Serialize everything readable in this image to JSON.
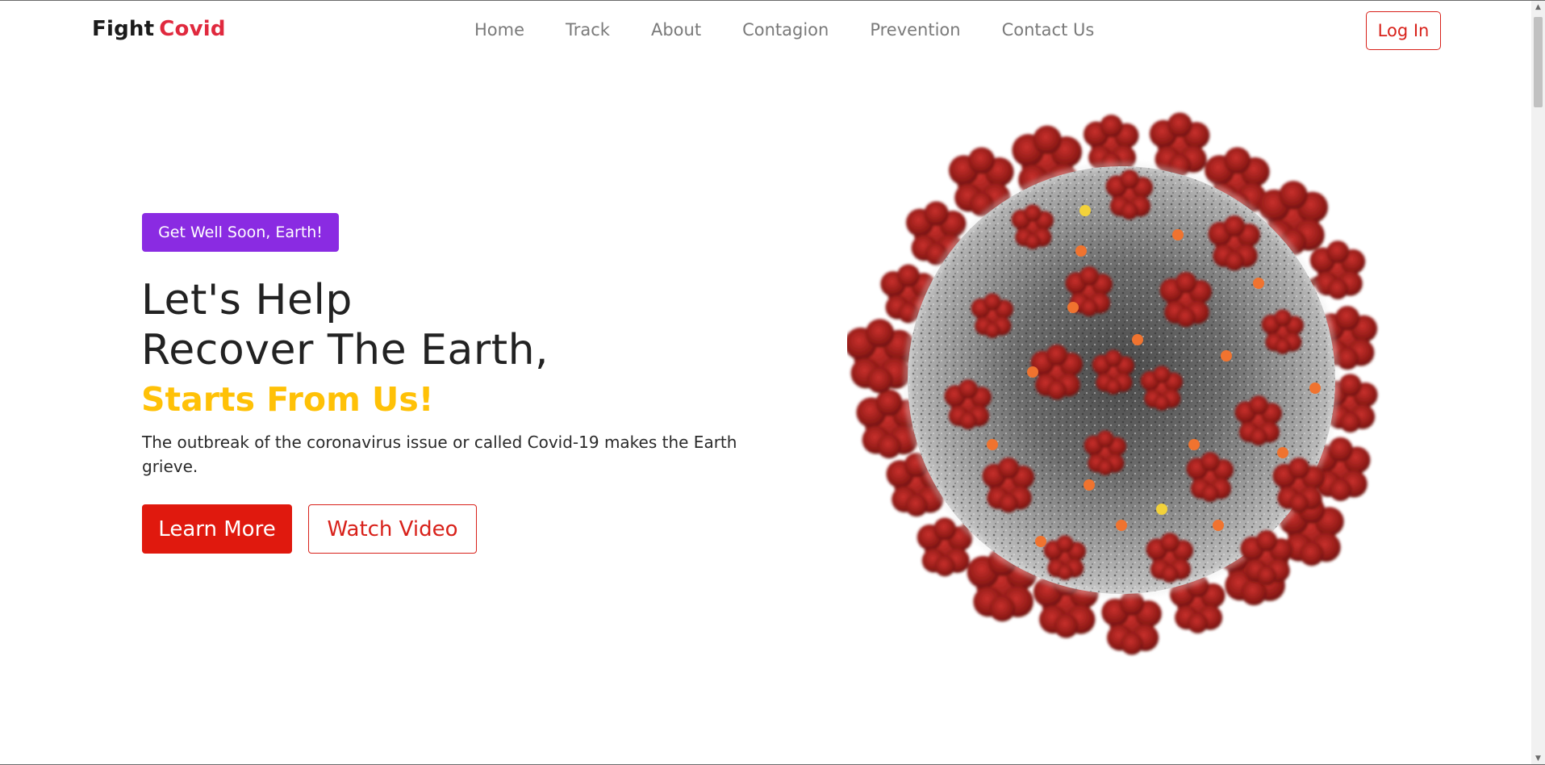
{
  "brand": {
    "first": "Fight",
    "second": "Covid"
  },
  "nav": {
    "links": [
      "Home",
      "Track",
      "About",
      "Contagion",
      "Prevention",
      "Contact Us"
    ],
    "login_label": "Log In"
  },
  "hero": {
    "badge": "Get Well Soon, Earth!",
    "headline_line1": "Let's Help",
    "headline_line2": "Recover The Earth,",
    "subheadline": "Starts From Us!",
    "description": "The outbreak of the coronavirus issue or called Covid-19 makes the Earth grieve.",
    "learn_more_label": "Learn More",
    "watch_video_label": "Watch Video",
    "image_icon": "coronavirus-illustration"
  },
  "colors": {
    "brand_accent": "#e0293e",
    "badge_purple": "#8a2be2",
    "highlight_yellow": "#ffc107",
    "primary_red": "#e0190e"
  }
}
